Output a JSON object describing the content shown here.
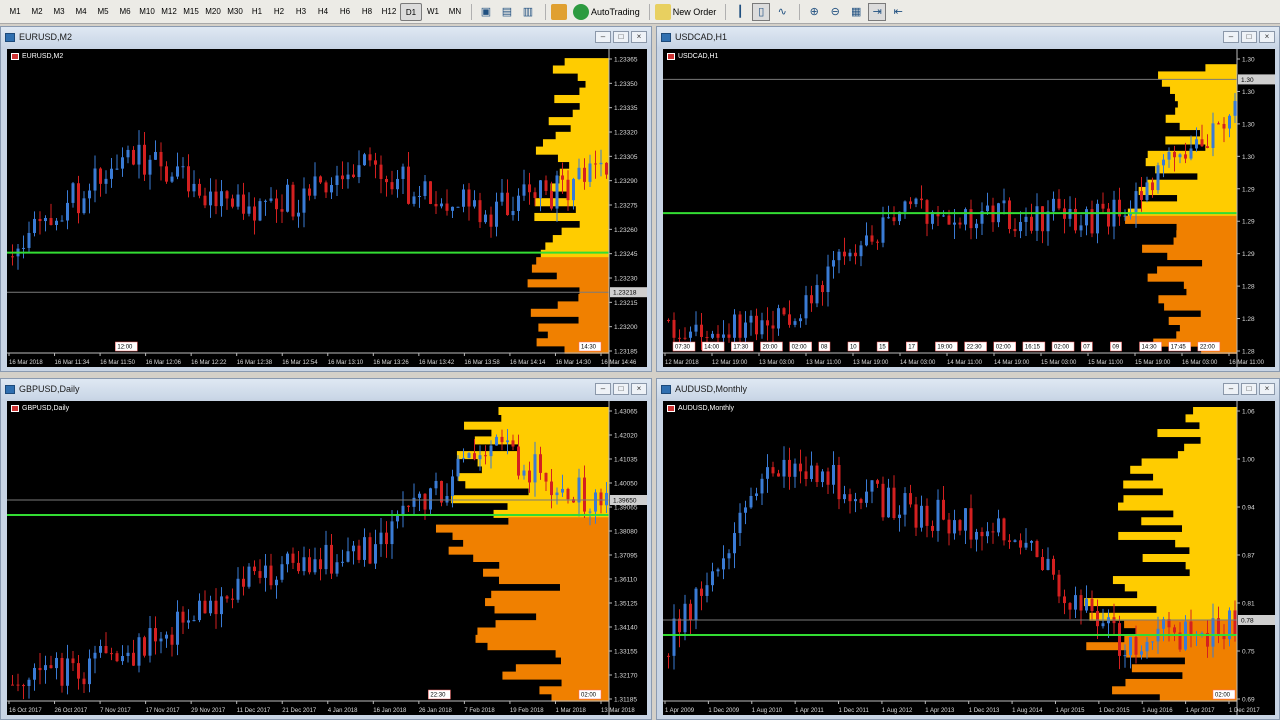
{
  "toolbar": {
    "timeframes": [
      "M1",
      "M2",
      "M3",
      "M4",
      "M5",
      "M6",
      "M10",
      "M12",
      "M15",
      "M20",
      "M30",
      "H1",
      "H2",
      "H3",
      "H4",
      "H6",
      "H8",
      "H12",
      "D1",
      "W1",
      "MN"
    ],
    "active_timeframe": "D1",
    "autotrading_label": "AutoTrading",
    "new_order_label": "New Order"
  },
  "charts": [
    {
      "id": "eurusd",
      "window_title": "EURUSD,M2",
      "chart_label": "EURUSD,M2",
      "price_labels": [
        "1.23365",
        "1.23350",
        "1.23335",
        "1.23320",
        "1.23305",
        "1.23290",
        "1.23275",
        "1.23260",
        "1.23245",
        "1.23230",
        "1.23215",
        "1.23200",
        "1.23185"
      ],
      "current_price": "1.23218",
      "time_labels": [
        "16 Mar 2018",
        "16 Mar 11:34",
        "16 Mar 11:50",
        "16 Mar 12:06",
        "16 Mar 12:22",
        "16 Mar 12:38",
        "16 Mar 12:54",
        "16 Mar 13:10",
        "16 Mar 13:26",
        "16 Mar 13:42",
        "16 Mar 13:58",
        "16 Mar 14:14",
        "16 Mar 14:30",
        "16 Mar 14:46"
      ],
      "session_labels": [
        "12:00",
        "14:30"
      ]
    },
    {
      "id": "usdcad",
      "window_title": "USDCAD,H1",
      "chart_label": "USDCAD,H1",
      "price_labels": [
        "1.30",
        "1.30",
        "1.30",
        "1.30",
        "1.29",
        "1.29",
        "1.29",
        "1.28",
        "1.28",
        "1.28"
      ],
      "current_price": "1.30",
      "time_labels": [
        "12 Mar 2018",
        "12 Mar 19:00",
        "13 Mar 03:00",
        "13 Mar 11:00",
        "13 Mar 19:00",
        "14 Mar 03:00",
        "14 Mar 11:00",
        "14 Mar 19:00",
        "15 Mar 03:00",
        "15 Mar 11:00",
        "15 Mar 19:00",
        "16 Mar 03:00",
        "16 Mar 11:00"
      ],
      "session_labels": [
        "07:30",
        "14:00",
        "17:30",
        "20:00",
        "02:00",
        "08",
        "10",
        "15",
        "17",
        "19:00",
        "22:30",
        "02:00",
        "16:15",
        "02:00",
        "07",
        "09",
        "14:30",
        "17:45",
        "22:00"
      ]
    },
    {
      "id": "gbpusd",
      "window_title": "GBPUSD,Daily",
      "chart_label": "GBPUSD,Daily",
      "price_labels": [
        "1.43065",
        "1.42020",
        "1.41035",
        "1.40050",
        "1.39065",
        "1.38080",
        "1.37095",
        "1.36110",
        "1.35125",
        "1.34140",
        "1.33155",
        "1.32170",
        "1.31185"
      ],
      "current_price": "1.39650",
      "time_labels": [
        "16 Oct 2017",
        "26 Oct 2017",
        "7 Nov 2017",
        "17 Nov 2017",
        "29 Nov 2017",
        "11 Dec 2017",
        "21 Dec 2017",
        "4 Jan 2018",
        "16 Jan 2018",
        "26 Jan 2018",
        "7 Feb 2018",
        "19 Feb 2018",
        "1 Mar 2018",
        "13 Mar 2018"
      ],
      "session_labels": [
        "22:30",
        "02:00"
      ]
    },
    {
      "id": "audusd",
      "window_title": "AUDUSD,Monthly",
      "chart_label": "AUDUSD,Monthly",
      "price_labels": [
        "1.06",
        "1.00",
        "0.94",
        "0.87",
        "0.81",
        "0.75",
        "0.69"
      ],
      "current_price": "0.78",
      "time_labels": [
        "1 Apr 2009",
        "1 Dec 2009",
        "1 Aug 2010",
        "1 Apr 2011",
        "1 Dec 2011",
        "1 Aug 2012",
        "1 Apr 2013",
        "1 Dec 2013",
        "1 Aug 2014",
        "1 Apr 2015",
        "1 Dec 2015",
        "1 Aug 2016",
        "1 Apr 2017",
        "1 Dec 2017"
      ],
      "session_labels": [
        "02:00"
      ]
    }
  ]
}
